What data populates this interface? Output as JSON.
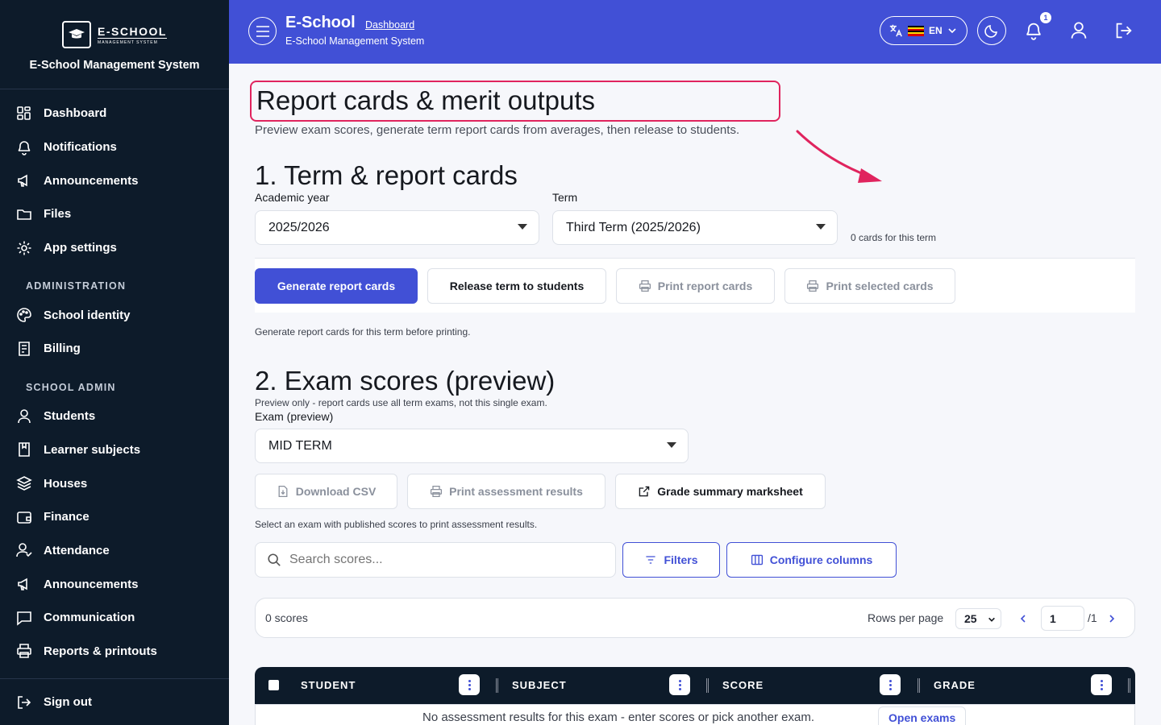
{
  "sidebar": {
    "logo_brand": "E-SCHOOL",
    "logo_sub": "MANAGEMENT SYSTEM",
    "system_name": "E-School Management System",
    "items": [
      {
        "label": "Dashboard",
        "icon": "grid-icon"
      },
      {
        "label": "Notifications",
        "icon": "bell-icon"
      },
      {
        "label": "Announcements",
        "icon": "megaphone-icon"
      },
      {
        "label": "Files",
        "icon": "folder-icon"
      },
      {
        "label": "App settings",
        "icon": "gear-icon"
      }
    ],
    "section_admin": "ADMINISTRATION",
    "admin_items": [
      {
        "label": "School identity",
        "icon": "palette-icon"
      },
      {
        "label": "Billing",
        "icon": "receipt-icon"
      }
    ],
    "section_school": "SCHOOL ADMIN",
    "school_items": [
      {
        "label": "Students",
        "icon": "user-icon"
      },
      {
        "label": "Learner subjects",
        "icon": "book-icon"
      },
      {
        "label": "Houses",
        "icon": "layers-icon"
      },
      {
        "label": "Finance",
        "icon": "wallet-icon"
      },
      {
        "label": "Attendance",
        "icon": "user-check-icon"
      },
      {
        "label": "Announcements",
        "icon": "megaphone-icon"
      },
      {
        "label": "Communication",
        "icon": "message-icon"
      },
      {
        "label": "Reports & printouts",
        "icon": "printer-icon"
      }
    ],
    "sign_out": "Sign out"
  },
  "header": {
    "title": "E-School",
    "breadcrumb": "Dashboard",
    "subtitle": "E-School Management System",
    "language": "EN",
    "notification_count": "1"
  },
  "page": {
    "title": "Report cards & merit outputs",
    "description": "Preview exam scores, generate term report cards from averages, then release to students."
  },
  "term_section": {
    "title": "1. Term & report cards",
    "academic_year_label": "Academic year",
    "academic_year_value": "2025/2026",
    "term_label": "Term",
    "term_value": "Third Term (2025/2026)",
    "cards_count": "0 cards for this term",
    "buttons": {
      "generate": "Generate report cards",
      "release": "Release term to students",
      "print": "Print report cards",
      "print_selected": "Print selected cards"
    },
    "hint": "Generate report cards for this term before printing."
  },
  "exam_section": {
    "title": "2. Exam scores (preview)",
    "note": "Preview only - report cards use all term exams, not this single exam.",
    "exam_label": "Exam (preview)",
    "exam_value": "MID TERM",
    "buttons": {
      "download_csv": "Download CSV",
      "print_results": "Print assessment results",
      "grade_summary": "Grade summary marksheet"
    },
    "hint": "Select an exam with published scores to print assessment results.",
    "search_placeholder": "Search scores...",
    "filters": "Filters",
    "configure_columns": "Configure columns",
    "scores_count": "0 scores",
    "rows_per_page_label": "Rows per page",
    "rows_per_page_value": "25",
    "page_current": "1",
    "page_total": "/1",
    "columns": [
      "STUDENT",
      "SUBJECT",
      "SCORE",
      "GRADE"
    ],
    "empty_message": "No assessment results for this exam - enter scores or pick another exam.",
    "open_exams": "Open exams"
  },
  "colors": {
    "accent": "#4150d6",
    "sidebar_bg": "#0d1b2a",
    "highlight": "#e0245e"
  }
}
